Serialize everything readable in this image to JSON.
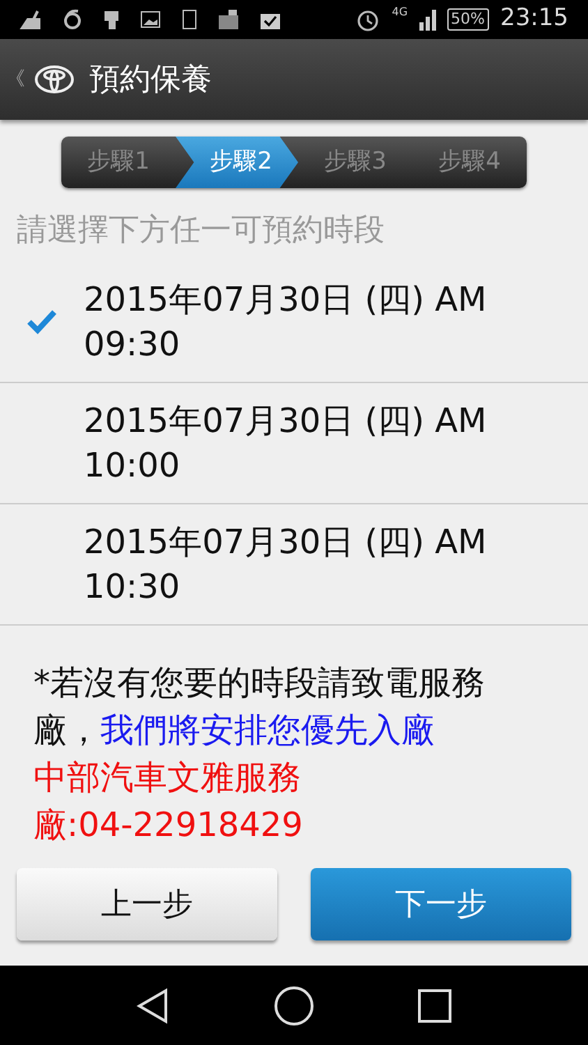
{
  "status_bar": {
    "network": "4G",
    "battery": "50%",
    "time": "23:15"
  },
  "header": {
    "back": "《",
    "title": "預約保養"
  },
  "steps": [
    {
      "label": "步驟1",
      "selected": false
    },
    {
      "label": "步驟2",
      "selected": true
    },
    {
      "label": "步驟3",
      "selected": false
    },
    {
      "label": "步驟4",
      "selected": false
    }
  ],
  "prompt": "請選擇下方任一可預約時段",
  "slots": [
    {
      "text": "2015年07月30日 (四) AM 09:30",
      "selected": true
    },
    {
      "text": "2015年07月30日 (四) AM 10:00",
      "selected": false
    },
    {
      "text": "2015年07月30日 (四) AM 10:30",
      "selected": false
    }
  ],
  "notice": {
    "text": "*若沒有您要的時段請致電服務廠，",
    "highlight": "我們將安排您優先入廠"
  },
  "contact": "中部汽車文雅服務廠:04-22918429",
  "buttons": {
    "back": "上一步",
    "next": "下一步"
  }
}
